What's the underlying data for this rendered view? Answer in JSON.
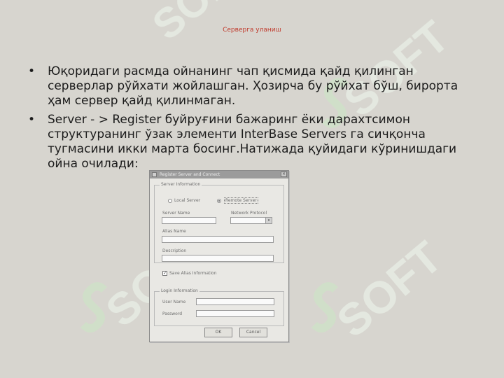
{
  "slide": {
    "title": "Серверга уланиш",
    "bullets": [
      "Юқоридаги расмда ойнанинг чап қисмида қайд қилинган серверлар рўйхати жойлашган. Ҳозирча бу рўйхат бўш, бирорта ҳам сервер қайд қилинмаган.",
      "Server - > Register буйруғини бажаринг ёки дарахтсимон структуранинг ўзак элементи InterBase Servers га сичқонча тугмасини икки марта босинг.Натижада қуйидаги кўринишдаги ойна очилади:"
    ],
    "bullet_glyph": "•",
    "watermark_text": "SOFT",
    "title_color": "#c0392b"
  },
  "dialog": {
    "title": "Register Server and Connect",
    "close_glyph": "×",
    "group_server": "Server Information",
    "radio_local": "Local Server",
    "radio_remote": "Remote Server",
    "label_server_name": "Server Name",
    "label_protocol": "Network Protocol",
    "label_alias": "Alias Name",
    "label_description": "Description",
    "check_save": "Save Alias Information",
    "check_glyph": "✓",
    "group_login": "Login Information",
    "label_user": "User Name",
    "label_password": "Password",
    "ok": "OK",
    "cancel": "Cancel",
    "arrow_glyph": "▾"
  }
}
